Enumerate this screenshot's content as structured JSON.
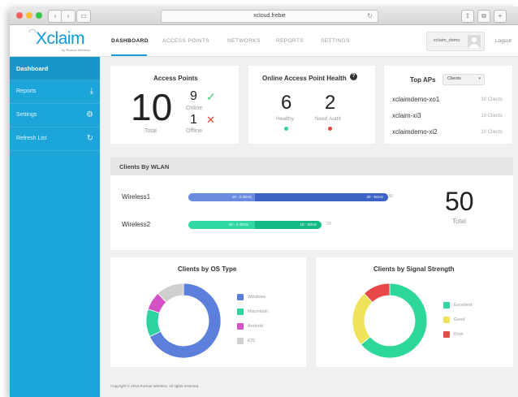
{
  "browser": {
    "url": "xcloud.frebie",
    "back_icon": "chevron-left-icon",
    "forward_icon": "chevron-right-icon",
    "reload_icon": "reload-icon"
  },
  "app": {
    "logo_text": "Xclaim",
    "logo_sub": "by Ruckus Wireless",
    "tabs": [
      {
        "label": "DASHBOARD",
        "active": true
      },
      {
        "label": "ACCESS POINTS",
        "active": false
      },
      {
        "label": "NETWORKS",
        "active": false
      },
      {
        "label": "REPORTS",
        "active": false
      },
      {
        "label": "SETTINGS",
        "active": false
      }
    ],
    "username": "xclaim_demo",
    "logout": "Logout"
  },
  "sidebar": {
    "items": [
      {
        "label": "Dashboard",
        "icon": "",
        "active": true
      },
      {
        "label": "Reports",
        "icon": "download-icon",
        "active": false
      },
      {
        "label": "Settings",
        "icon": "gear-icon",
        "active": false
      },
      {
        "label": "Refresh List",
        "icon": "refresh-icon",
        "active": false
      }
    ]
  },
  "access_points": {
    "title": "Access Points",
    "total": "10",
    "total_label": "Total",
    "online": "9",
    "online_label": "Online",
    "offline": "1",
    "offline_label": "Offline"
  },
  "health": {
    "title": "Online Access Point Health",
    "healthy": "6",
    "healthy_label": "Healthy",
    "need_audit": "2",
    "need_audit_label": "Need Audit"
  },
  "top_aps": {
    "title": "Top APs",
    "select_value": "Clients",
    "rows": [
      {
        "name": "xclaimdemo-xo1",
        "value": "30 Clients"
      },
      {
        "name": "xclaim-xi3",
        "value": "10 Clients"
      },
      {
        "name": "xclaimdemo-xi2",
        "value": "10 Clients"
      }
    ]
  },
  "wlan": {
    "title": "Clients By WLAN",
    "total": "50",
    "total_label": "Total",
    "rows": [
      {
        "name": "Wireless1",
        "seg1_label": "10 - 2.4GHz",
        "seg1_value": 10,
        "seg2_label": "20 - 5GHz",
        "seg2_value": 20,
        "total": "30"
      },
      {
        "name": "Wireless2",
        "seg1_label": "10 - 2.4GHz",
        "seg1_value": 10,
        "seg2_label": "10 - 5GHz",
        "seg2_value": 10,
        "total": "20"
      }
    ]
  },
  "os_chart": {
    "title": "Clients by OS Type",
    "legend": [
      {
        "label": "Windows",
        "color": "#5b7fdb"
      },
      {
        "label": "Macintosh",
        "color": "#2fd3a2"
      },
      {
        "label": "Android",
        "color": "#d452c4"
      },
      {
        "label": "iOS",
        "color": "#cfcfcf"
      }
    ]
  },
  "signal_chart": {
    "title": "Clients by Signal Strength",
    "legend": [
      {
        "label": "Excellent",
        "color": "#2dd79a"
      },
      {
        "label": "Good",
        "color": "#eee35a"
      },
      {
        "label": "Poor",
        "color": "#e94848"
      }
    ]
  },
  "chart_data": [
    {
      "type": "pie",
      "categories": [
        "Windows",
        "Macintosh",
        "Android",
        "iOS"
      ],
      "values": [
        68,
        12,
        8,
        12
      ],
      "colors": [
        "#5b7fdb",
        "#2fd3a2",
        "#d452c4",
        "#cfcfcf"
      ],
      "title": "Clients by OS Type",
      "legend": "right"
    },
    {
      "type": "pie",
      "categories": [
        "Excellent",
        "Good",
        "Poor"
      ],
      "values": [
        64,
        24,
        12
      ],
      "colors": [
        "#2dd79a",
        "#eee35a",
        "#e94848"
      ],
      "title": "Clients by Signal Strength",
      "legend": "right"
    }
  ],
  "footer": "Copyright © 2015 Ruckus Wireless. All rights reserved.",
  "colors": {
    "brand": "#1ba5d9",
    "online_check": "#3cc77a",
    "offline_x": "#e0483e",
    "healthy_dot": "#2fd3a2",
    "audit_dot": "#e0483e"
  }
}
